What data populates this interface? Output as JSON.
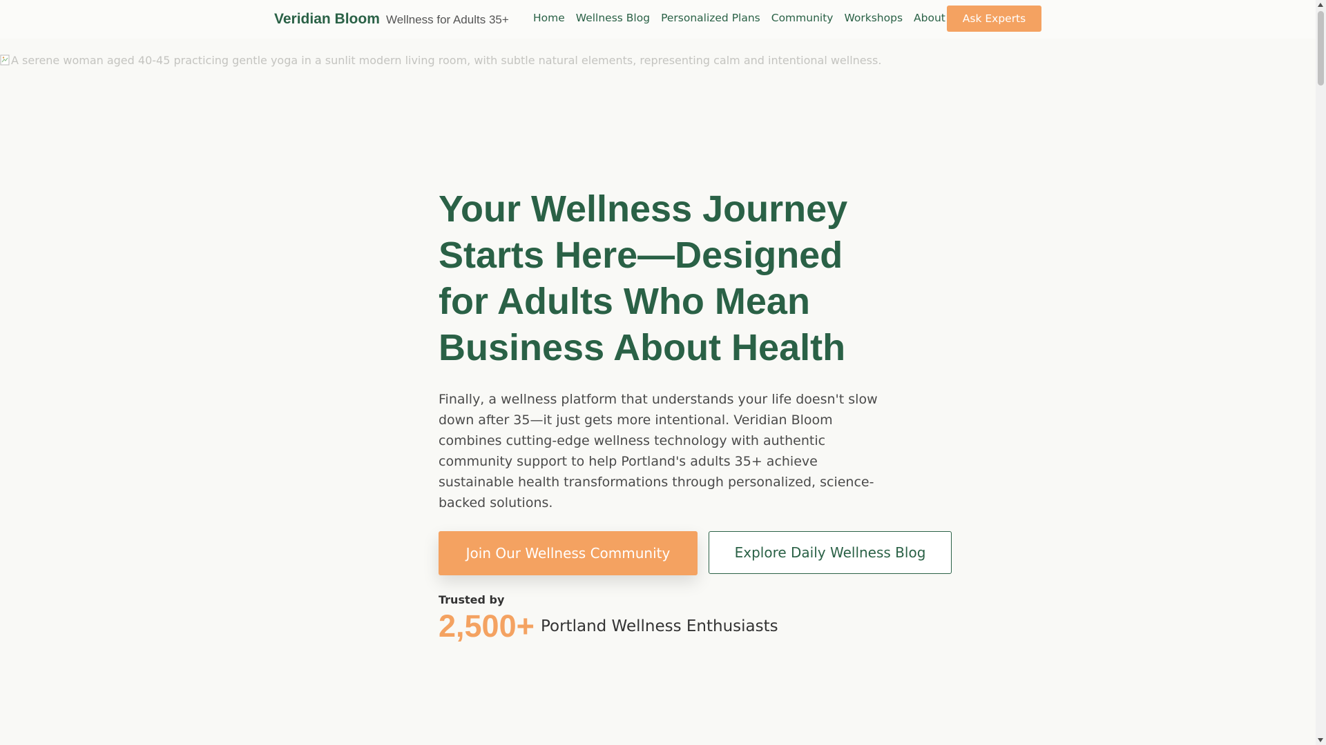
{
  "header": {
    "brand_name": "Veridian Bloom",
    "brand_tagline": "Wellness for Adults 35+",
    "nav": [
      {
        "label": "Home"
      },
      {
        "label": "Wellness Blog"
      },
      {
        "label": "Personalized Plans"
      },
      {
        "label": "Community"
      },
      {
        "label": "Workshops"
      },
      {
        "label": "About"
      }
    ],
    "cta_label": "Ask Experts"
  },
  "hero_image": {
    "alt_text": "A serene woman aged 40-45 practicing gentle yoga in a sunlit modern living room, with subtle natural elements, representing calm and intentional wellness.",
    "icon": "broken-image-icon"
  },
  "hero": {
    "title": "Your Wellness Journey Starts Here—Designed for Adults Who Mean Business About Health",
    "description": "Finally, a wellness platform that understands your life doesn't slow down after 35—it just gets more intentional. Veridian Bloom combines cutting-edge wellness technology with authentic community support to help Portland's adults 35+ achieve sustainable health transformations through personalized, science-backed solutions.",
    "primary_cta": "Join Our Wellness Community",
    "secondary_cta": "Explore Daily Wellness Blog",
    "trust_label": "Trusted by",
    "trust_count": "2,500+",
    "trust_text": "Portland Wellness Enthusiasts"
  },
  "colors": {
    "brand_green": "#2a6146",
    "accent_orange": "#f4a261",
    "background": "#f9f9f6"
  }
}
